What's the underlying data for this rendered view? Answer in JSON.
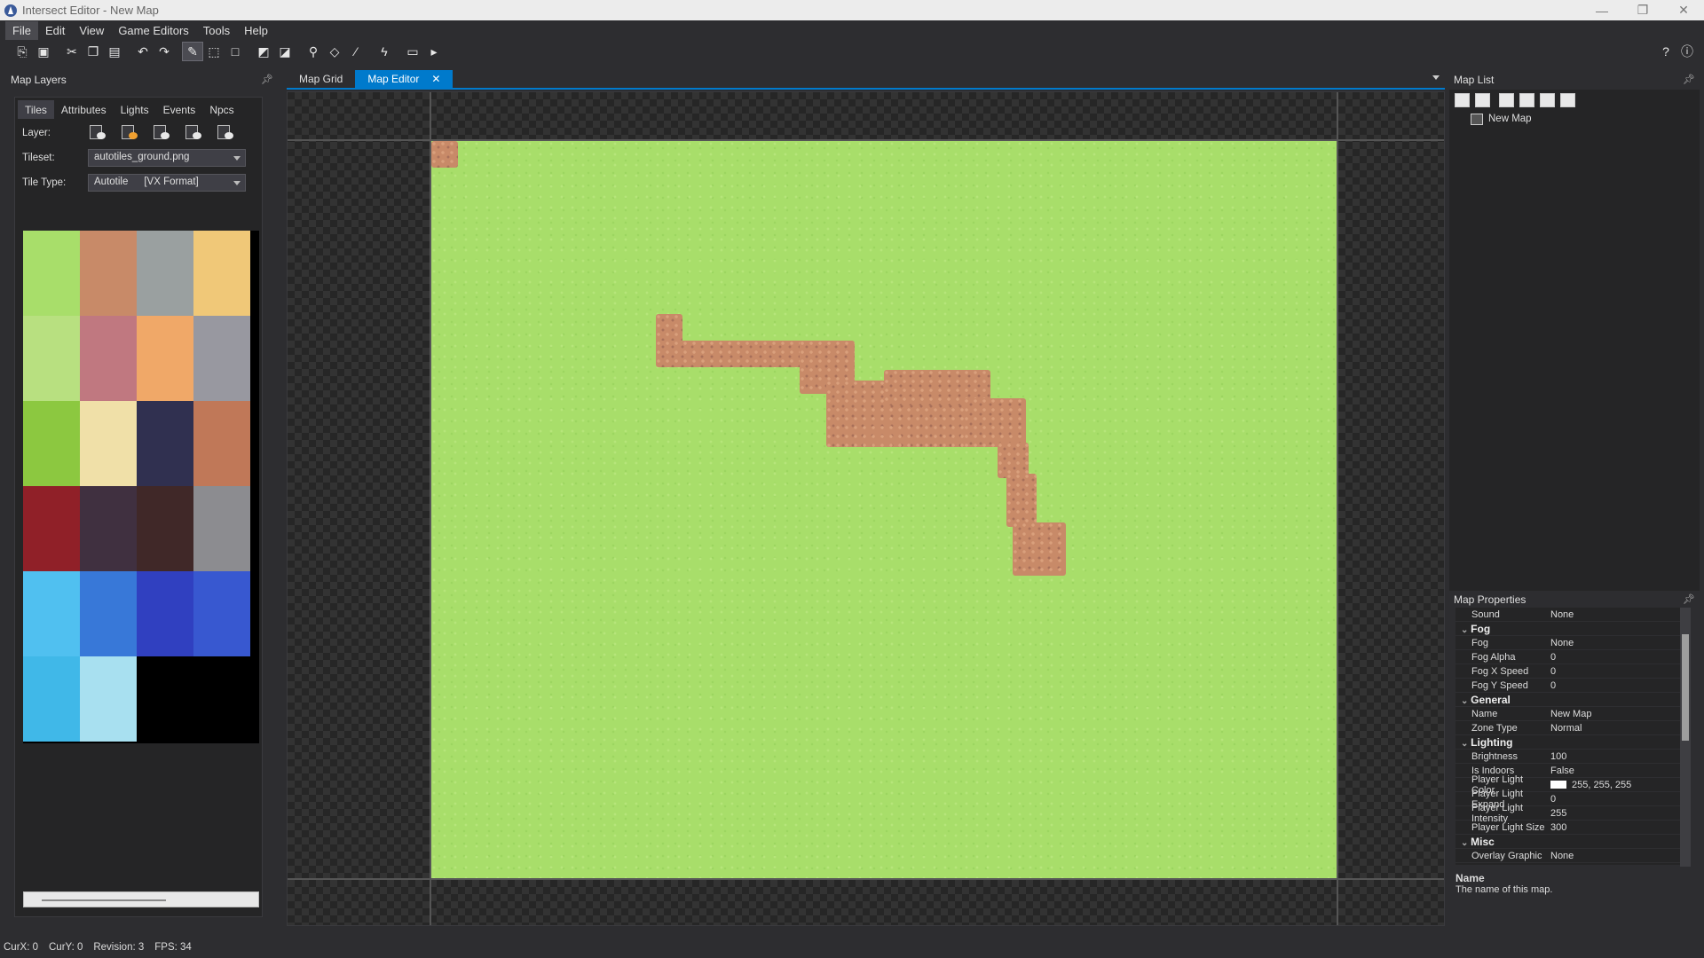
{
  "window": {
    "title": "Intersect Editor - New Map",
    "controls": [
      "—",
      "❐",
      "✕"
    ]
  },
  "menu": [
    "File",
    "Edit",
    "View",
    "Game Editors",
    "Tools",
    "Help"
  ],
  "toolbar_icons": [
    "new-map-icon",
    "save-icon",
    "cut-icon",
    "copy-icon",
    "paste-icon",
    "undo-icon",
    "redo-icon",
    "pen-tool-icon",
    "selection-tool-icon",
    "rectangle-tool-icon",
    "fill-icon",
    "erase-fill-icon",
    "dropper-icon",
    "eraser-icon",
    "brush-icon",
    "lightning-icon",
    "screenshot-icon",
    "play-icon",
    "help-icon",
    "info-icon"
  ],
  "map_layers": {
    "title": "Map Layers",
    "tabs": [
      "Tiles",
      "Attributes",
      "Lights",
      "Events",
      "Npcs"
    ],
    "layer_label": "Layer:",
    "tileset_label": "Tileset:",
    "tileset_value": "autotiles_ground.png",
    "tiletype_label": "Tile Type:",
    "tiletype_value": "Autotile",
    "tiletype_format": "[VX Format]"
  },
  "doc_tabs": {
    "grid": "Map Grid",
    "editor": "Map Editor",
    "close": "✕"
  },
  "map_list": {
    "title": "Map List",
    "item": "New Map"
  },
  "map_properties": {
    "title": "Map Properties",
    "rows": [
      {
        "k": "Sound",
        "v": "None"
      },
      {
        "cat": "Fog"
      },
      {
        "k": "Fog",
        "v": "None"
      },
      {
        "k": "Fog Alpha",
        "v": "0"
      },
      {
        "k": "Fog X Speed",
        "v": "0"
      },
      {
        "k": "Fog Y Speed",
        "v": "0"
      },
      {
        "cat": "General"
      },
      {
        "k": "Name",
        "v": "New Map"
      },
      {
        "k": "Zone Type",
        "v": "Normal"
      },
      {
        "cat": "Lighting"
      },
      {
        "k": "Brightness",
        "v": "100"
      },
      {
        "k": "Is Indoors",
        "v": "False"
      },
      {
        "k": "Player Light Color",
        "v": "255, 255, 255",
        "swatch": "#ffffff"
      },
      {
        "k": "Player Light Expand",
        "v": "0"
      },
      {
        "k": "Player Light Intensity",
        "v": "255"
      },
      {
        "k": "Player Light Size",
        "v": "300"
      },
      {
        "cat": "Misc"
      },
      {
        "k": "Overlay Graphic",
        "v": "None"
      }
    ],
    "desc_name": "Name",
    "desc_text": "The name of this map."
  },
  "status": {
    "curx": "CurX: 0",
    "cury": "CurY: 0",
    "revision": "Revision: 3",
    "fps": "FPS: 34"
  },
  "colors": {
    "accent": "#007acc",
    "grass": "#a8de6a",
    "dirt": "#c88a68"
  }
}
